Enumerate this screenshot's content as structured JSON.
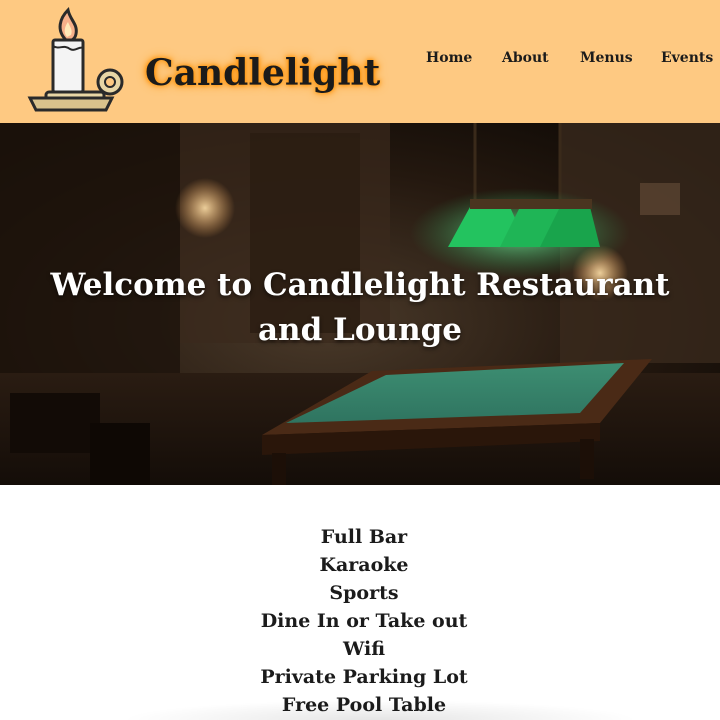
{
  "header": {
    "brand": "Candlelight",
    "logo_icon": "candle-icon",
    "background_color": "#fec982"
  },
  "nav": {
    "items": [
      {
        "label": "Home"
      },
      {
        "label": "About"
      },
      {
        "label": "Menus"
      },
      {
        "label": "Events"
      }
    ]
  },
  "hero": {
    "title_line1": "Welcome to Candlelight Restaurant",
    "title_line2": "and Lounge",
    "image": "pool-table-room-photo"
  },
  "features": {
    "items": [
      "Full Bar",
      "Karaoke",
      "Sports",
      "Dine In or Take out",
      "Wifi",
      "Private Parking Lot",
      "Free Pool Table"
    ]
  }
}
